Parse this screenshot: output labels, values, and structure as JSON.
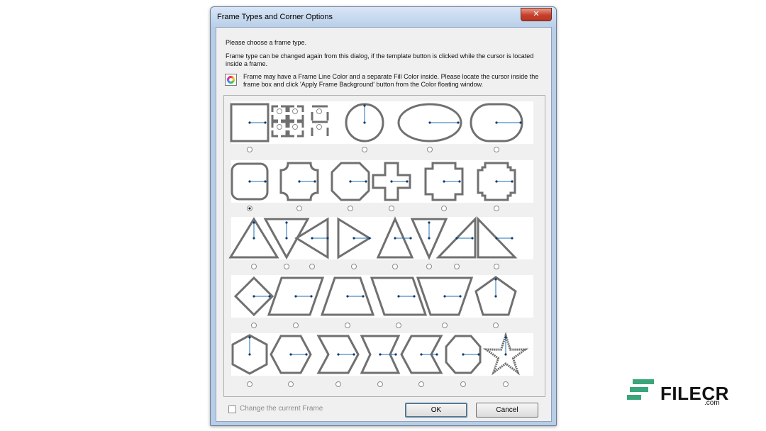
{
  "dialog": {
    "title": "Frame Types and Corner Options",
    "close_label": "✕",
    "intro": "Please choose a frame type.",
    "note_line1": "Frame type can be changed again from this dialog, if the template button is clicked while the cursor is located",
    "note_line2": "inside a frame.",
    "color_note_line1": "Frame may have a Frame Line Color and a separate Fill Color inside. Please locate the cursor inside the",
    "color_note_line2": "frame box and click 'Apply Frame Background' button from the Color floating window.",
    "change_current_label": "Change the current Frame",
    "ok_label": "OK",
    "cancel_label": "Cancel"
  },
  "frame_rows": [
    [
      "square",
      "bracket-corners",
      "circle",
      "ellipse",
      "rounded-pill"
    ],
    [
      "rounded-square",
      "concave-corner",
      "octagon-chamfer",
      "cross",
      "notched-square",
      "stepped-notch"
    ],
    [
      "triangle-up",
      "triangle-down",
      "triangle-left",
      "triangle-right",
      "triangle-up-small",
      "triangle-down-small",
      "right-triangle-left",
      "right-triangle-right"
    ],
    [
      "diamond",
      "parallelogram",
      "trapezoid-up",
      "parallelogram-reverse",
      "trapezoid-down",
      "pentagon"
    ],
    [
      "hexagon-vertical",
      "hexagon-horizontal",
      "chevron-right",
      "hourglass-horizontal",
      "chevron-left",
      "octagon",
      "star"
    ]
  ],
  "selected_frame": "rounded-square",
  "colors": {
    "shape_stroke": "#707070",
    "center_line": "#1f6db5"
  },
  "watermark": {
    "brand": "FILECR",
    "domain": ".com",
    "accent": "#3aa57a"
  }
}
